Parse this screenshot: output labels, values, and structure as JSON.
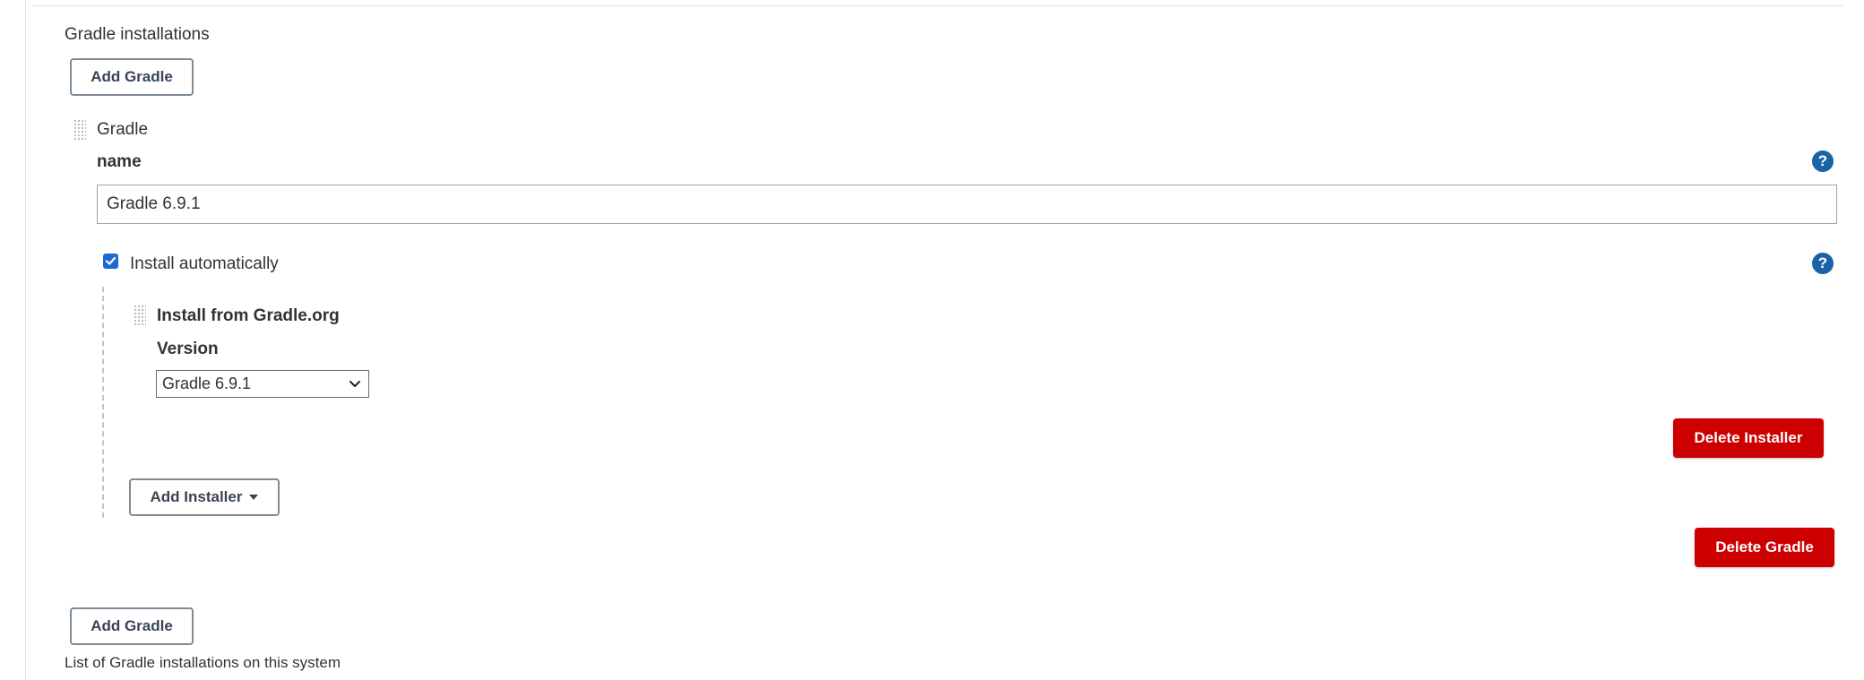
{
  "section": {
    "title": "Gradle installations",
    "description": "List of Gradle installations on this system"
  },
  "buttons": {
    "add_gradle": "Add Gradle",
    "add_installer": "Add Installer",
    "delete_installer": "Delete Installer",
    "delete_gradle": "Delete Gradle"
  },
  "gradle_entry": {
    "header": "Gradle",
    "name_label": "name",
    "name_value": "Gradle 6.9.1",
    "install_automatically_label": "Install automatically",
    "install_automatically_checked": true,
    "installer": {
      "title": "Install from Gradle.org",
      "version_label": "Version",
      "version_value": "Gradle 6.9.1"
    }
  },
  "help_symbol": "?",
  "colors": {
    "danger": "#cc0000",
    "help": "#1a63a8",
    "checkbox": "#1a6bd0"
  }
}
